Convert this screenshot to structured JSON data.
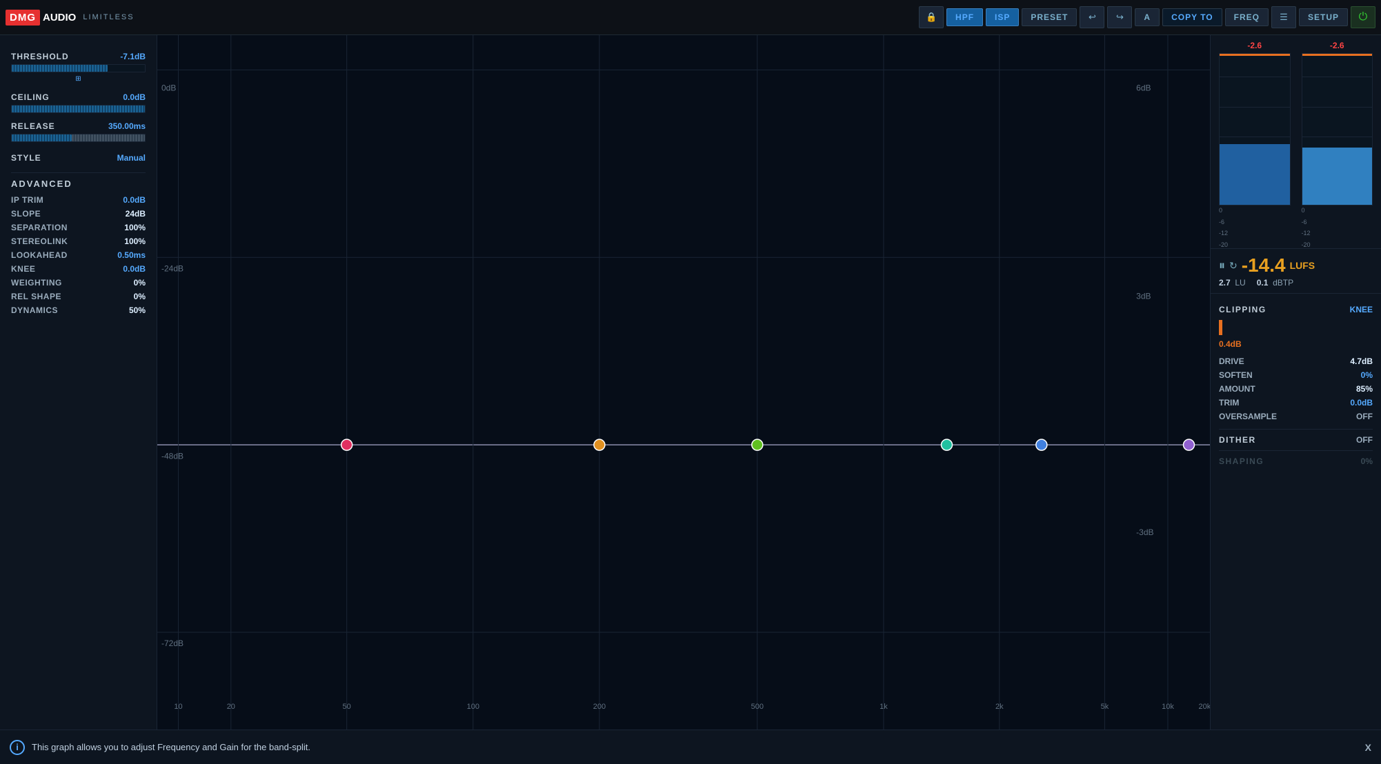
{
  "header": {
    "logo_dmg": "DMG",
    "logo_audio": "AUDIO",
    "logo_limitless": "LIMITLESS",
    "btn_hpf": "HPF",
    "btn_isp": "ISP",
    "btn_preset": "PRESET",
    "btn_a": "A",
    "btn_copy_to": "COPY TO",
    "btn_freq": "FREQ",
    "btn_setup": "SETUP"
  },
  "left": {
    "threshold_label": "THRESHOLD",
    "threshold_value": "-7.1dB",
    "ceiling_label": "CEILING",
    "ceiling_value": "0.0dB",
    "release_label": "RELEASE",
    "release_value": "350.00ms",
    "style_label": "STYLE",
    "style_value": "Manual",
    "advanced_title": "ADVANCED",
    "ip_trim_label": "IP TRIM",
    "ip_trim_value": "0.0dB",
    "slope_label": "SLOPE",
    "slope_value": "24dB",
    "separation_label": "SEPARATION",
    "separation_value": "100%",
    "stereolink_label": "STEREOLINK",
    "stereolink_value": "100%",
    "lookahead_label": "LOOKAHEAD",
    "lookahead_value": "0.50ms",
    "knee_label": "KNEE",
    "knee_value": "0.0dB",
    "weighting_label": "WEIGHTING",
    "weighting_value": "0%",
    "rel_shape_label": "REL SHAPE",
    "rel_shape_value": "0%",
    "dynamics_label": "DYNAMICS",
    "dynamics_value": "50%"
  },
  "graph": {
    "db_labels": [
      "0dB",
      "-24dB",
      "-48dB",
      "-72dB"
    ],
    "db_right_labels": [
      "6dB",
      "3dB",
      "-3dB"
    ],
    "freq_labels": [
      "10",
      "20",
      "50",
      "100",
      "200",
      "500",
      "1k",
      "2k",
      "5k",
      "10k",
      "20k"
    ],
    "band_colors": [
      "#e03060",
      "#e09020",
      "#60c020",
      "#20c0a0",
      "#4080e0",
      "#9060d0"
    ],
    "threshold_line_db": "-48dB"
  },
  "meters": {
    "left_peak": "-2.6",
    "right_peak": "-2.6",
    "scale_labels": [
      "0",
      "-6",
      "-12",
      "-20"
    ]
  },
  "loudness": {
    "lufs_value": "-14.4",
    "lufs_unit": "LUFS",
    "lu_label": "LU",
    "lu_value": "2.7",
    "dbtp_label": "dBTP",
    "dbtp_value": "0.1"
  },
  "right_params": {
    "clipping_label": "CLIPPING",
    "knee_label": "KNEE",
    "clipping_bar_value": "0.4dB",
    "drive_label": "DRIVE",
    "drive_value": "4.7dB",
    "soften_label": "SOFTEN",
    "soften_value": "0%",
    "amount_label": "AMOUNT",
    "amount_value": "85%",
    "trim_label": "TRIM",
    "trim_value": "0.0dB",
    "oversample_label": "OVERSAMPLE",
    "oversample_value": "OFF",
    "dither_label": "DITHER",
    "dither_value": "OFF",
    "shaping_label": "SHAPING",
    "shaping_value": "0%"
  },
  "bottom": {
    "info_text": "This graph allows you to adjust Frequency and Gain for the band-split.",
    "close_label": "X"
  }
}
